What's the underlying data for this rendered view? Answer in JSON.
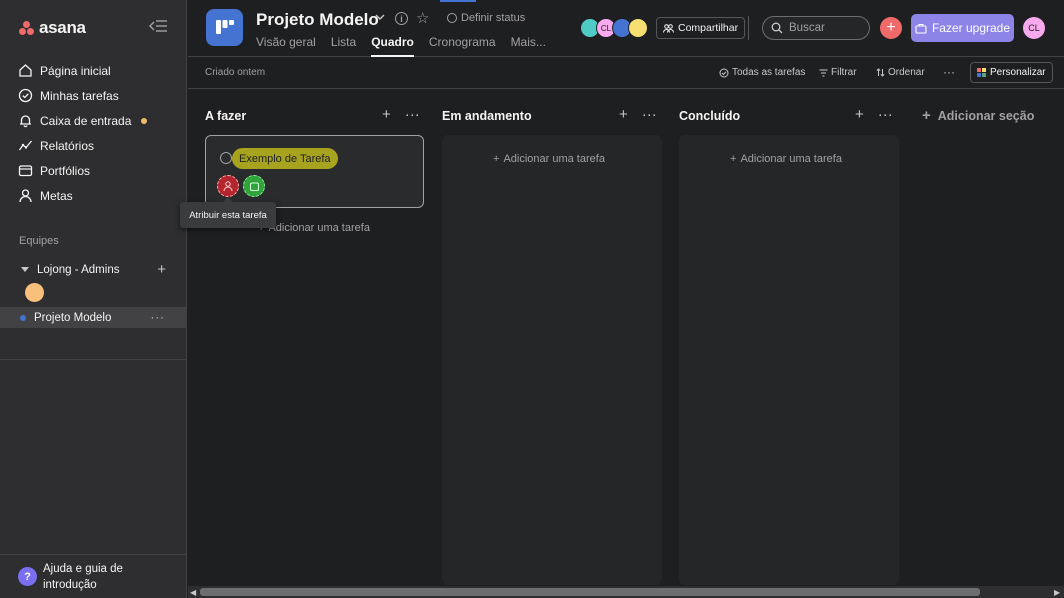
{
  "app": {
    "name": "asana"
  },
  "sidebar": {
    "items": [
      {
        "label": "Página inicial",
        "icon": "home-icon"
      },
      {
        "label": "Minhas tarefas",
        "icon": "check-circle-icon"
      },
      {
        "label": "Caixa de entrada",
        "icon": "bell-icon"
      },
      {
        "label": "Relatórios",
        "icon": "chart-line-icon"
      },
      {
        "label": "Portfólios",
        "icon": "folder-icon"
      },
      {
        "label": "Metas",
        "icon": "person-icon"
      }
    ],
    "teams_label": "Equipes",
    "team_name": "Lojong - Admins",
    "project_name": "Projeto Modelo",
    "project_more": "···",
    "help_label": "Ajuda e guia de introdução",
    "help_icon_char": "?"
  },
  "header": {
    "project_title": "Projeto Modelo",
    "status_label": "Definir status",
    "tabs": [
      {
        "label": "Visão geral"
      },
      {
        "label": "Lista"
      },
      {
        "label": "Quadro",
        "active": true
      },
      {
        "label": "Cronograma"
      },
      {
        "label": "Mais..."
      }
    ],
    "avatars": [
      {
        "initials": "",
        "color": "#4ecbc4"
      },
      {
        "initials": "CL",
        "color": "#f9aaef"
      },
      {
        "initials": "",
        "color": "#4573d2"
      },
      {
        "initials": "",
        "color": "#f8df72"
      }
    ],
    "share_label": "Compartilhar",
    "search_placeholder": "Buscar",
    "upgrade_label": "Fazer upgrade",
    "user_initials": "CL"
  },
  "toolbar": {
    "created_text": "Criado ontem",
    "all_tasks": "Todas as tarefas",
    "filter": "Filtrar",
    "sort": "Ordenar",
    "more": "···",
    "personalize": "Personalizar"
  },
  "board": {
    "columns": [
      {
        "title": "A fazer",
        "add_task": "Adicionar uma tarefa"
      },
      {
        "title": "Em andamento",
        "add_task": "Adicionar uma tarefa"
      },
      {
        "title": "Concluído",
        "add_task": "Adicionar uma tarefa"
      }
    ],
    "card": {
      "title": "Exemplo de Tarefa"
    },
    "tooltip": "Atribuir esta tarefa",
    "add_section": "Adicionar seção"
  },
  "colors": {
    "accent_red": "#f06a6a",
    "upgrade_purple": "#8d84e8",
    "project_blue": "#4573d2"
  }
}
